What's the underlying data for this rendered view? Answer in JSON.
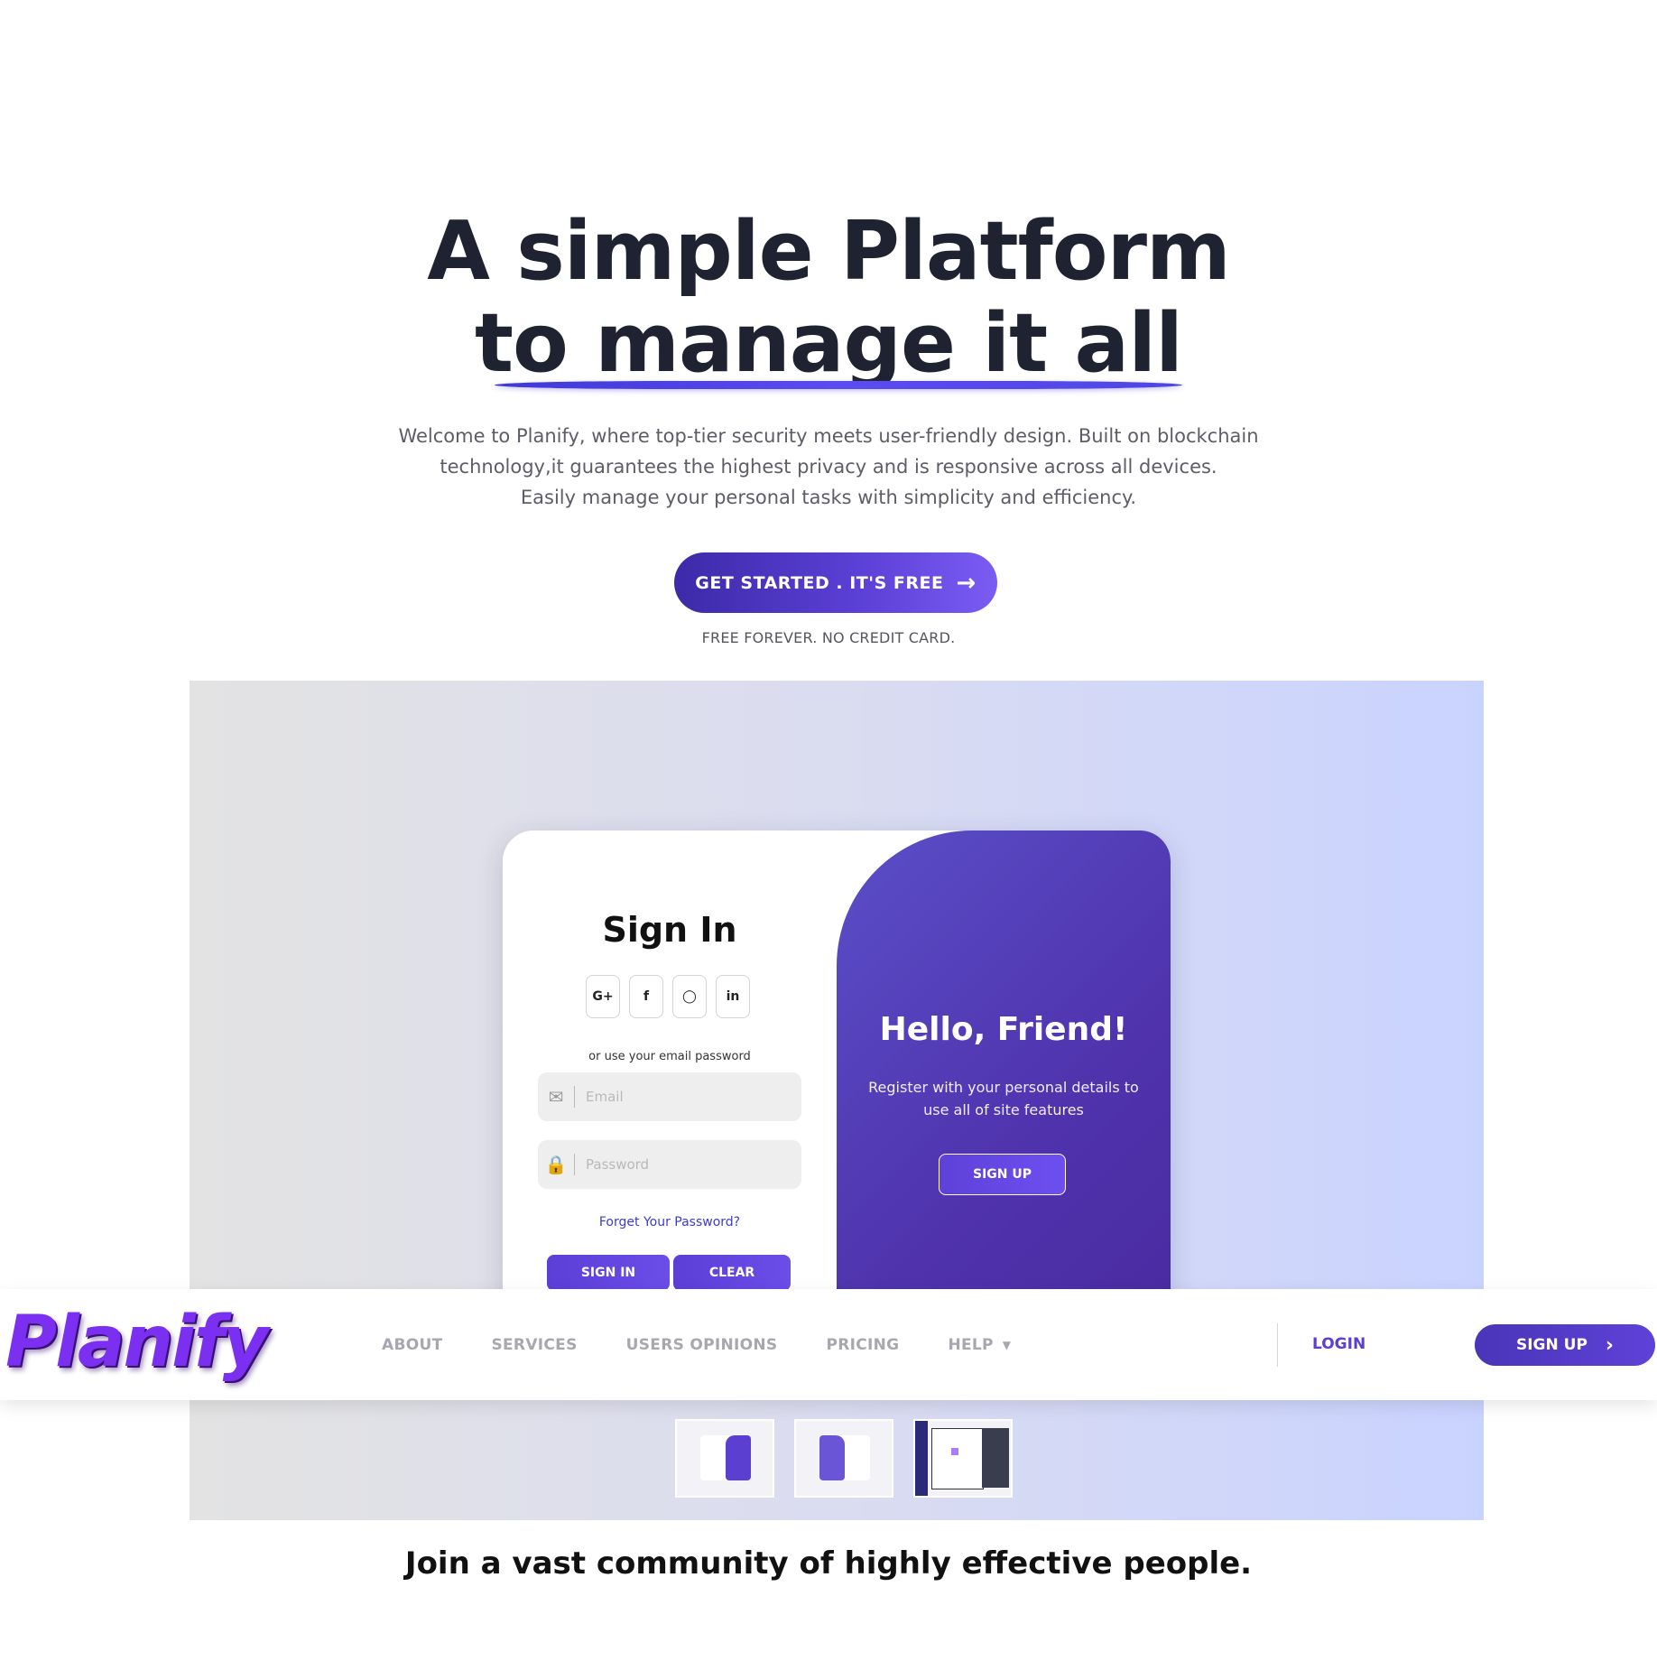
{
  "hero": {
    "title_line1": "A simple Platform",
    "title_line2": "to manage it all",
    "desc_line1": "Welcome to Planify, where top-tier security meets user-friendly design. Built on blockchain",
    "desc_line2": "technology,it guarantees the highest privacy and is responsive across all devices.",
    "desc_line3": "Easily manage your personal tasks with simplicity and efficiency.",
    "cta_label": "GET STARTED . IT'S FREE",
    "cta_note": "FREE FOREVER. NO CREDIT CARD."
  },
  "preview": {
    "signin_title": "Sign In",
    "socials": [
      "G+",
      "f",
      "◯",
      "in"
    ],
    "or_text": "or use your email password",
    "email_placeholder": "Email",
    "password_placeholder": "Password",
    "forgot": "Forget Your Password?",
    "signin_button": "SIGN IN",
    "clear_button": "CLEAR",
    "hello": "Hello, Friend!",
    "register_text": "Register with your personal details to use all of site features",
    "signup_button": "SIGN UP"
  },
  "navbar": {
    "logo": "Planify",
    "links": [
      "ABOUT",
      "SERVICES",
      "USERS OPINIONS",
      "PRICING",
      "HELP"
    ],
    "login": "LOGIN",
    "signup": "SIGN UP"
  },
  "footer": {
    "join": "Join a vast community of highly effective people."
  },
  "colors": {
    "accent": "#5b3fd4",
    "logo": "#7b2ff0",
    "text": "#1f2230"
  }
}
